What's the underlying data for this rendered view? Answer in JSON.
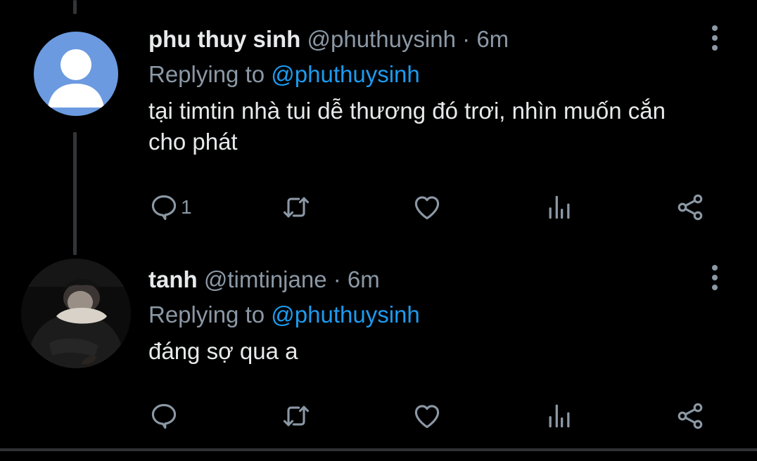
{
  "tweets": [
    {
      "name": "phu thuy sinh",
      "handle": "@phuthuysinh",
      "separator": "·",
      "time": "6m",
      "replying_prefix": "Replying to",
      "replying_handle": "@phuthuysinh",
      "text": "tại timtin nhà tui dễ thương đó trơi, nhìn muốn cắn cho phát",
      "reply_count": "1",
      "avatar": "default-avatar-icon"
    },
    {
      "name": "tanh",
      "handle": "@timtinjane",
      "separator": "·",
      "time": "6m",
      "replying_prefix": "Replying to",
      "replying_handle": "@phuthuysinh",
      "text": "đáng sợ qua a",
      "reply_count": "",
      "avatar": "user-photo"
    }
  ],
  "colors": {
    "background": "#000000",
    "text": "#e7e9ea",
    "secondary": "#8b98a5",
    "link": "#1d9bf0",
    "thread_line": "#333639",
    "default_avatar": "#6b9ae0"
  }
}
